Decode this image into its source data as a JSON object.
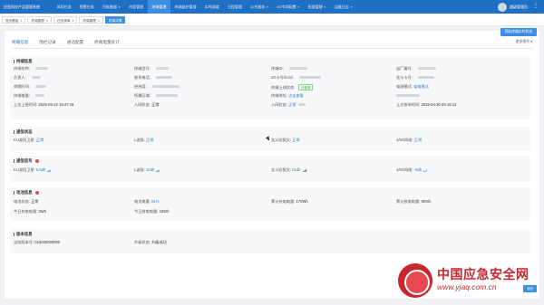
{
  "header": {
    "brand": "应急科技产品管理系统",
    "nav": [
      {
        "label": "风险任务",
        "has_caret": false
      },
      {
        "label": "预警任务",
        "has_caret": false
      },
      {
        "label": "目标数据",
        "has_caret": true
      },
      {
        "label": "内容管理",
        "has_caret": false
      },
      {
        "label": "终端管理",
        "has_caret": false,
        "active": true
      },
      {
        "label": "终端维护管理",
        "has_caret": false
      },
      {
        "label": "实时调度",
        "has_caret": false
      },
      {
        "label": "日程管理",
        "has_caret": false
      },
      {
        "label": "公共服务",
        "has_caret": true
      },
      {
        "label": "4G专网配置",
        "has_caret": true
      },
      {
        "label": "权限管理",
        "has_caret": true
      },
      {
        "label": "运维日志",
        "has_caret": true
      }
    ],
    "user_name": "超级管理员"
  },
  "tags": [
    {
      "label": "首页看板"
    },
    {
      "label": "终端管理"
    },
    {
      "label": "任务清单"
    },
    {
      "label": "终端管理"
    },
    {
      "label": "终端详情",
      "active": true
    }
  ],
  "tabs": [
    {
      "label": "终端信息",
      "active": true
    },
    {
      "label": "围栏记录"
    },
    {
      "label": "通话配置"
    },
    {
      "label": "终端电量统计"
    }
  ],
  "more_label": "更多操作",
  "action_button": "获取终端实时状态",
  "bottom_button": "返回",
  "terminal_info": {
    "title": "终端信息",
    "labels": [
      "终端名称:",
      "负责人:",
      "休眠时间:",
      "终端电量:",
      "上次上报时间:",
      "终端型号:",
      "联系电话:",
      "经纬度:",
      "所属区域:",
      "入网状态:",
      "终端ID:",
      "4G卡号/iccid:",
      "终端上线状态:",
      "终端地址:",
      "入网状态:",
      "出厂编号:",
      "北斗卡号:",
      "电源模式:",
      "上次查询时间:"
    ],
    "last_report": "2025-05-22 19:47:18",
    "net_status_1": "正常",
    "online_status": "已登录",
    "address_link": "点击查看",
    "net_status_2": "正常",
    "power_mode": "省电模式",
    "last_query": "2025-04-30 09:16:12"
  },
  "comm_status": {
    "title": "通信状态",
    "ku_label": "KU波段卫星:",
    "ku_value": "正常",
    "l_label": "L波段:",
    "l_value": "正常",
    "beidou_label": "北斗短报文:",
    "beidou_value": "正常",
    "net_label": "4/5G网络:",
    "net_value": "正常"
  },
  "comm_signal": {
    "title": "通信信号",
    "ku_label": "KU波段卫星:",
    "ku_value": "5.5db",
    "l_label": "L波段:",
    "l_value": "10db",
    "beidou_label": "北斗短报文:",
    "beidou_value": "51db",
    "net_label": "4/5G网络:",
    "net_value": "-9db"
  },
  "power_info": {
    "title": "电池信息",
    "status_label": "电池状态:",
    "status_value": "正常",
    "level_label": "电池电量:",
    "level_value": "81%",
    "charge_label": "累计充电电量:",
    "charge_value": "170Wh",
    "discharge_label": "累计放电电量:",
    "discharge_value": "90Wh",
    "today_charge_label": "今日充电电量:",
    "today_charge_value": "0Wh",
    "today_discharge_label": "今日放电电量:",
    "today_discharge_value": "10Wh"
  },
  "version_info": {
    "title": "版本信息",
    "firmware_label": "当前版本号:",
    "firmware_value": "015005000000",
    "upgrade_label": "升级状态:",
    "upgrade_value": "升级成功"
  },
  "watermark": {
    "title": "中国应急安全网",
    "url": "www.yjaq.com.cn"
  },
  "colors": {
    "header_bg": "#1f6fc5",
    "accent": "#3b8ee2",
    "ok_green": "#2e9c2e",
    "badge_red": "#e84a4a",
    "watermark_red": "#c8262e"
  }
}
